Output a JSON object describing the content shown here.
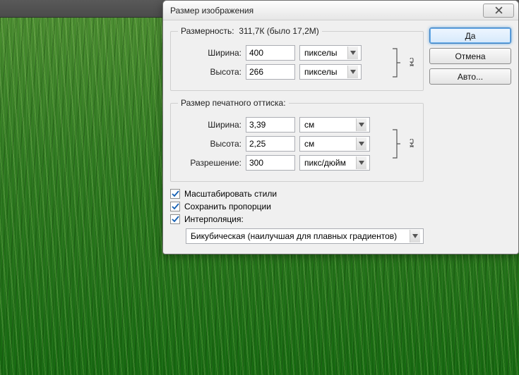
{
  "toolbar": {},
  "dialog": {
    "title": "Размер изображения",
    "pixel_dims": {
      "legend": "Размерность:",
      "info": "311,7К (было 17,2M)",
      "width_label": "Ширина:",
      "width_value": "400",
      "height_label": "Высота:",
      "height_value": "266",
      "unit_width": "пикселы",
      "unit_height": "пикселы"
    },
    "print_dims": {
      "legend": "Размер печатного оттиска:",
      "width_label": "Ширина:",
      "width_value": "3,39",
      "height_label": "Высота:",
      "height_value": "2,25",
      "unit_width": "см",
      "unit_height": "см",
      "res_label": "Разрешение:",
      "res_value": "300",
      "res_unit": "пикс/дюйм"
    },
    "options": {
      "scale_styles": "Масштабировать стили",
      "constrain": "Сохранить пропорции",
      "resample": "Интерполяция:",
      "resample_method": "Бикубическая (наилучшая для плавных градиентов)"
    },
    "buttons": {
      "ok": "Да",
      "cancel": "Отмена",
      "auto": "Авто..."
    }
  }
}
